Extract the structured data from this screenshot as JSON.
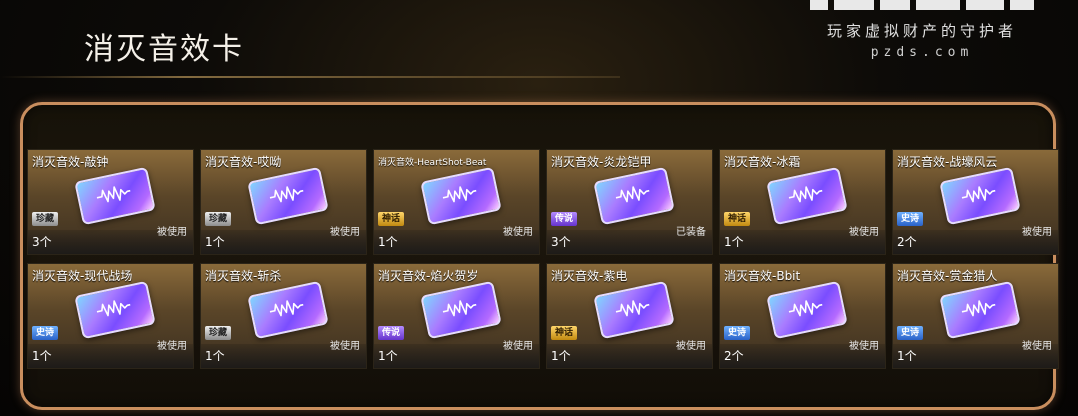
{
  "header": {
    "title": "消灭音效卡"
  },
  "brand": {
    "tagline": "玩家虚拟财产的守护者",
    "url": "pzds.com"
  },
  "cards": [
    {
      "name": "消灭音效-敲钟",
      "badge": "珍藏",
      "rarity": "rare",
      "status": "被使用",
      "count": "3个"
    },
    {
      "name": "消灭音效-哎呦",
      "badge": "珍藏",
      "rarity": "rare",
      "status": "被使用",
      "count": "1个"
    },
    {
      "name": "消灭音效-HeartShot-Beat",
      "badge": "神话",
      "rarity": "myth",
      "status": "被使用",
      "count": "1个"
    },
    {
      "name": "消灭音效-炎龙铠甲",
      "badge": "传说",
      "rarity": "legend",
      "status": "已装备",
      "count": "3个"
    },
    {
      "name": "消灭音效-冰霜",
      "badge": "神话",
      "rarity": "myth",
      "status": "被使用",
      "count": "1个"
    },
    {
      "name": "消灭音效-战壕风云",
      "badge": "史诗",
      "rarity": "epic",
      "status": "被使用",
      "count": "2个"
    },
    {
      "name": "消灭音效-现代战场",
      "badge": "史诗",
      "rarity": "epic",
      "status": "被使用",
      "count": "1个"
    },
    {
      "name": "消灭音效-斩杀",
      "badge": "珍藏",
      "rarity": "rare",
      "status": "被使用",
      "count": "1个"
    },
    {
      "name": "消灭音效-焰火贺岁",
      "badge": "传说",
      "rarity": "legend",
      "status": "被使用",
      "count": "1个"
    },
    {
      "name": "消灭音效-紫电",
      "badge": "神话",
      "rarity": "myth",
      "status": "被使用",
      "count": "1个"
    },
    {
      "name": "消灭音效-Bbit",
      "badge": "史诗",
      "rarity": "epic",
      "status": "被使用",
      "count": "2个"
    },
    {
      "name": "消灭音效-赏金猎人",
      "badge": "史诗",
      "rarity": "epic",
      "status": "被使用",
      "count": "1个"
    }
  ],
  "colors": {
    "panel_border": "#c98e5e",
    "card_gold": "#8a6a3a"
  }
}
